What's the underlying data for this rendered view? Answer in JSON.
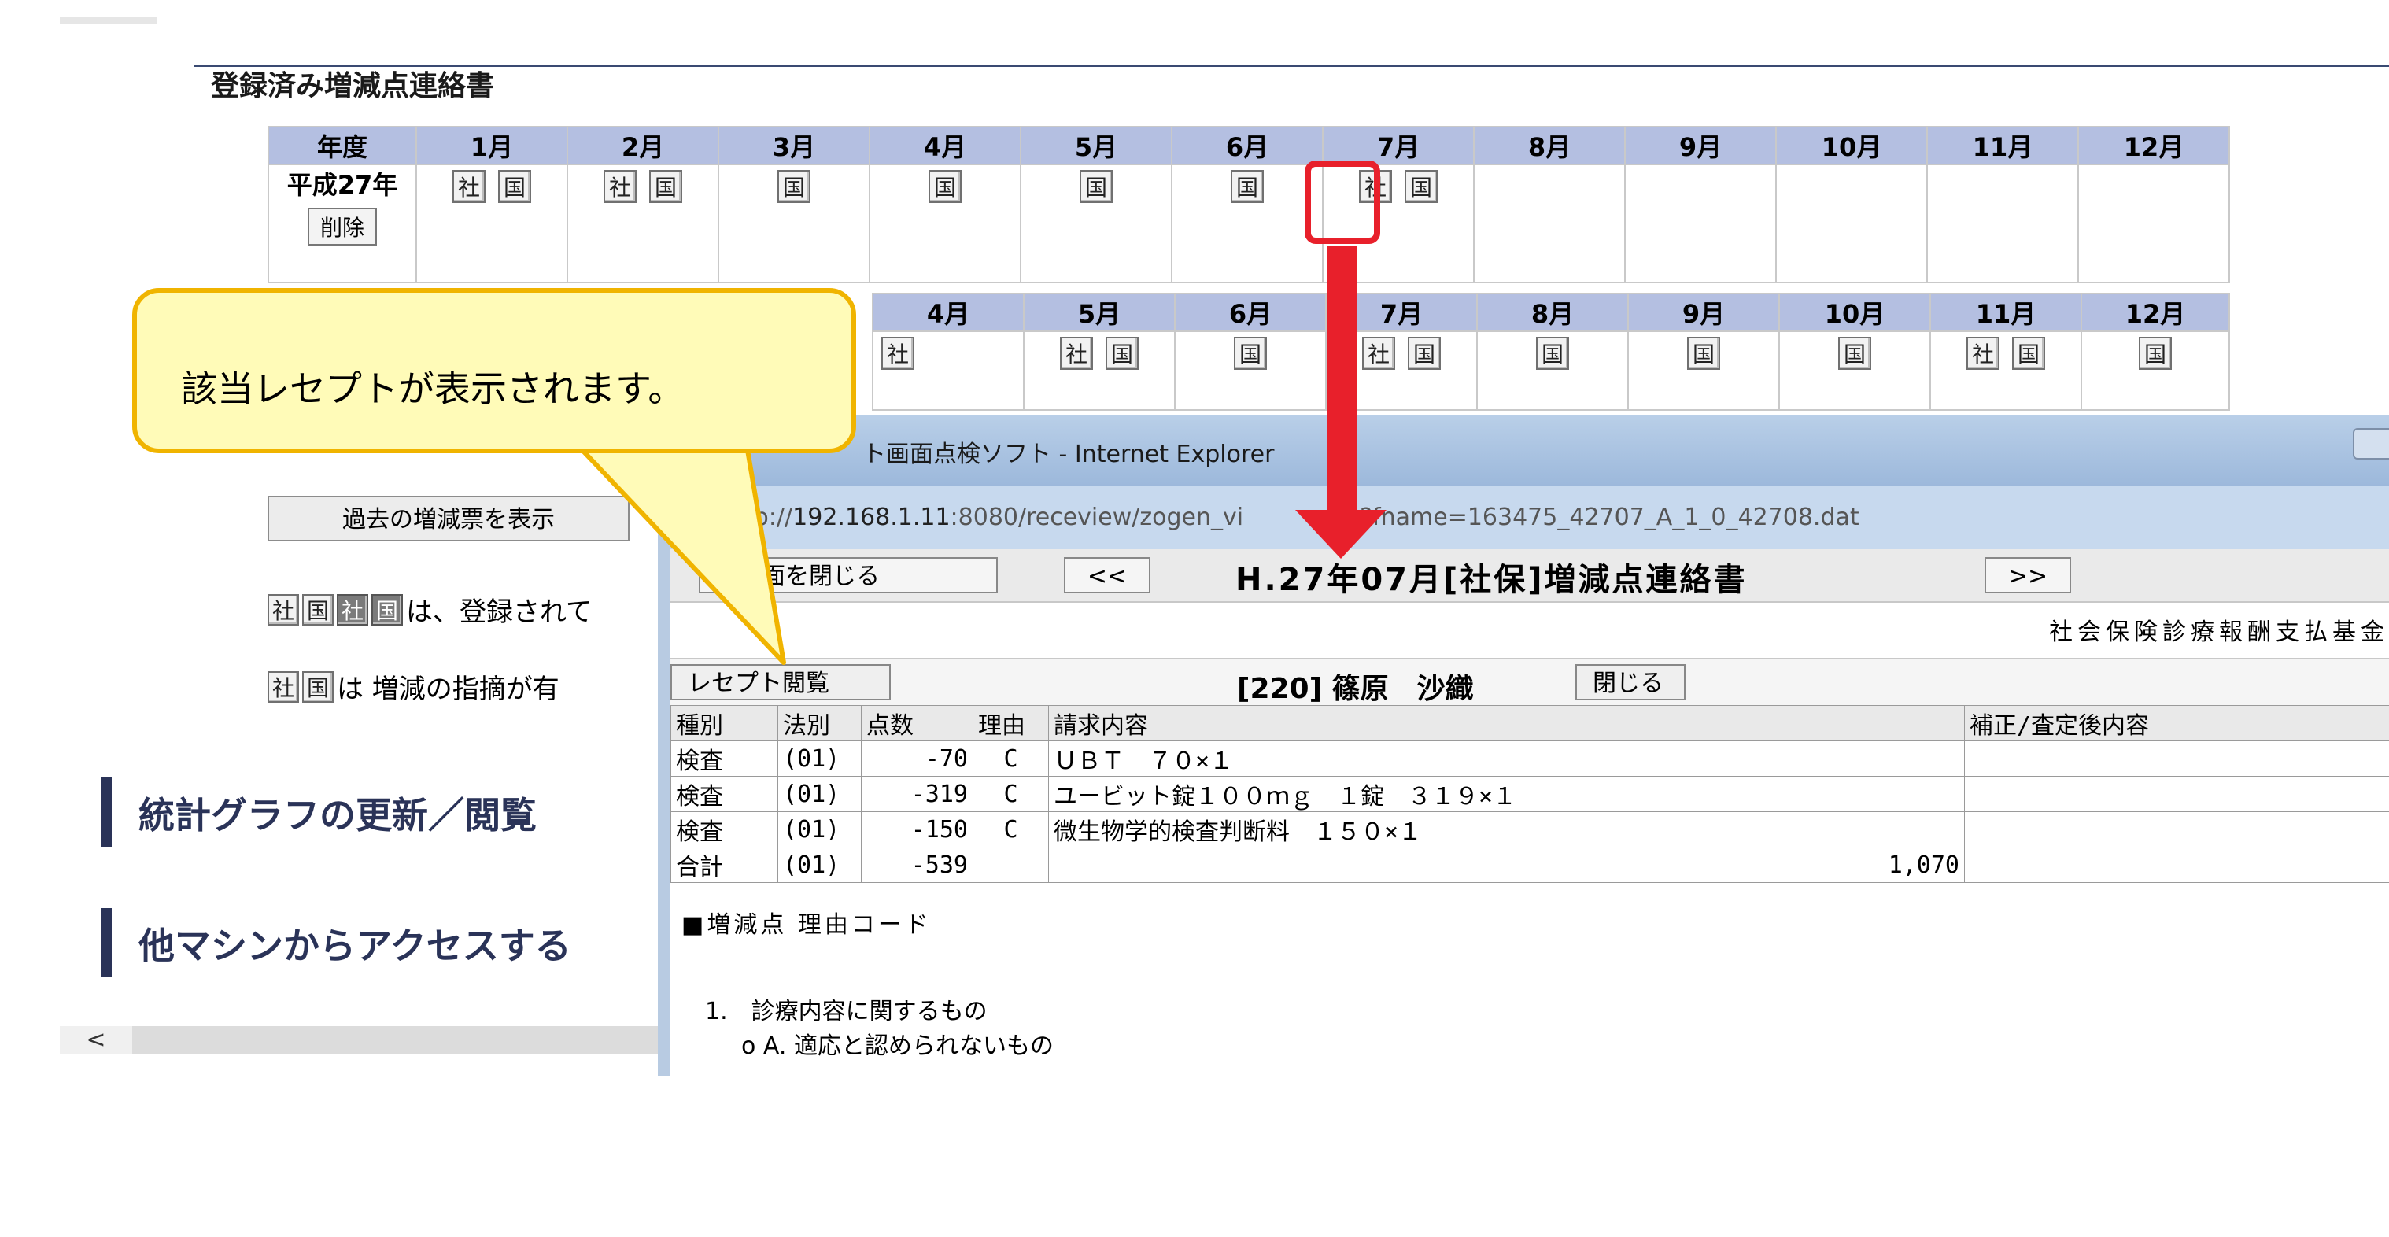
{
  "section_title": "登録済み増減点連絡書",
  "month_header": {
    "year_label": "年度",
    "months": [
      "1月",
      "2月",
      "3月",
      "4月",
      "5月",
      "6月",
      "7月",
      "8月",
      "9月",
      "10月",
      "11月",
      "12月"
    ]
  },
  "row1": {
    "year": "平成27年",
    "delete_label": "削除",
    "cells": [
      [
        "社",
        "国"
      ],
      [
        "社",
        "国"
      ],
      [
        "国"
      ],
      [
        "国"
      ],
      [
        "国"
      ],
      [
        "国"
      ],
      [
        "社",
        "国"
      ],
      [],
      [],
      [],
      [],
      []
    ]
  },
  "row2": {
    "months_visible": [
      "4月",
      "5月",
      "6月",
      "7月",
      "8月",
      "9月",
      "10月",
      "11月",
      "12月"
    ],
    "cells": [
      [
        "社"
      ],
      [
        "社",
        "国"
      ],
      [
        "国"
      ],
      [
        "社",
        "国"
      ],
      [
        "国"
      ],
      [
        "国"
      ],
      [
        "国"
      ],
      [
        "社",
        "国"
      ],
      [
        "国"
      ]
    ]
  },
  "left": {
    "past_button": "過去の増減票を表示",
    "legend1_tags": [
      "社",
      "国",
      "社",
      "国"
    ],
    "legend1_text": "は、登録されて",
    "legend2_tags": [
      "社",
      "国"
    ],
    "legend2_text": "は 増減の指摘が有",
    "heading1": "統計グラフの更新／閲覧",
    "heading2": "他マシンからアクセスする",
    "scroll_left": "<"
  },
  "popup": {
    "window_title": "ト画面点検ソフト - Internet Explorer",
    "url_prefix": "tp://",
    "url_host": "192.168.1.11",
    "url_rest": ":8080/receview/zogen_vi",
    "url_tail": "hp?fname=163475_42707_A_1_0_42708.dat",
    "close_screen": "の画面を閉じる",
    "prev": "<<",
    "next": ">>",
    "doc_title": "H.27年07月[社保]増減点連絡書",
    "issuer": "社会保険診療報酬支払基金",
    "receipt_button": "レセプト閲覧",
    "patient": "[220] 篠原　沙織",
    "close": "閉じる",
    "columns": [
      "種別",
      "法別",
      "点数",
      "理由",
      "請求内容",
      "補正/査定後内容"
    ],
    "rows": [
      [
        "検査",
        "(01)",
        "-70",
        "C",
        "ＵＢＴ　７０×１",
        ""
      ],
      [
        "検査",
        "(01)",
        "-319",
        "C",
        "ユービット錠１００ｍｇ　１錠　３１９×１",
        ""
      ],
      [
        "検査",
        "(01)",
        "-150",
        "C",
        "微生物学的検査判断料　１５０×１",
        ""
      ],
      [
        "合計",
        "(01)",
        "-539",
        "",
        "1,070",
        ""
      ]
    ],
    "reason_head": "■増減点 理由コード",
    "reason_1": "1.　診療内容に関するもの",
    "reason_1a": "o A. 適応と認められないもの"
  },
  "callout": "該当レセプトが表示されます。",
  "colors": {
    "header_bg": "#b4bfe1",
    "highlight_red": "#e8202b",
    "callout_fill": "#fffbb8",
    "callout_border": "#f0b400",
    "heading_navy": "#2a3358"
  }
}
